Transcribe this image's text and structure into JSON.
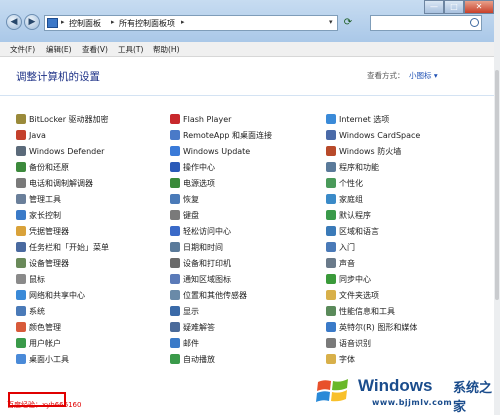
{
  "window": {
    "controls": [
      "—",
      "□",
      "✕"
    ]
  },
  "address": {
    "segments": [
      "控制面板",
      "所有控制面板项"
    ],
    "refresh_icon": "refresh-icon",
    "search_icon": "search-icon"
  },
  "menu": [
    "文件(F)",
    "编辑(E)",
    "查看(V)",
    "工具(T)",
    "帮助(H)"
  ],
  "heading": "调整计算机的设置",
  "view": {
    "label": "查看方式：",
    "value": "小图标 ▾"
  },
  "columns": [
    [
      {
        "label": "BitLocker 驱动器加密",
        "icon": "bitlocker-icon",
        "color": "#9a8a3a"
      },
      {
        "label": "Java",
        "icon": "java-icon",
        "color": "#c4402c"
      },
      {
        "label": "Windows Defender",
        "icon": "defender-icon",
        "color": "#5b6a7a"
      },
      {
        "label": "备份和还原",
        "icon": "backup-icon",
        "color": "#3c8a3c"
      },
      {
        "label": "电话和调制解调器",
        "icon": "phone-icon",
        "color": "#7a7a7a"
      },
      {
        "label": "管理工具",
        "icon": "admin-tools-icon",
        "color": "#6a7f9a"
      },
      {
        "label": "家长控制",
        "icon": "parental-controls-icon",
        "color": "#3a7ac8"
      },
      {
        "label": "凭据管理器",
        "icon": "credential-manager-icon",
        "color": "#d9a23a"
      },
      {
        "label": "任务栏和「开始」菜单",
        "icon": "taskbar-icon",
        "color": "#4a6aa0"
      },
      {
        "label": "设备管理器",
        "icon": "device-manager-icon",
        "color": "#6a8a5a"
      },
      {
        "label": "鼠标",
        "icon": "mouse-icon",
        "color": "#8a8a8a"
      },
      {
        "label": "网络和共享中心",
        "icon": "network-icon",
        "color": "#3a8ad8"
      },
      {
        "label": "系统",
        "icon": "system-icon",
        "color": "#4a7ab8"
      },
      {
        "label": "颜色管理",
        "icon": "color-management-icon",
        "color": "#d85a3a"
      },
      {
        "label": "用户帐户",
        "icon": "user-accounts-icon",
        "color": "#3a9a4a"
      },
      {
        "label": "桌面小工具",
        "icon": "gadgets-icon",
        "color": "#4a8ad8"
      }
    ],
    [
      {
        "label": "Flash Player",
        "icon": "flash-icon",
        "color": "#c8282c"
      },
      {
        "label": "RemoteApp 和桌面连接",
        "icon": "remoteapp-icon",
        "color": "#4a7ac8"
      },
      {
        "label": "Windows Update",
        "icon": "windows-update-icon",
        "color": "#3a7ad8"
      },
      {
        "label": "操作中心",
        "icon": "action-center-icon",
        "color": "#2a5ab8"
      },
      {
        "label": "电源选项",
        "icon": "power-icon",
        "color": "#3a8a3a"
      },
      {
        "label": "恢复",
        "icon": "recovery-icon",
        "color": "#4a7ab8"
      },
      {
        "label": "键盘",
        "icon": "keyboard-icon",
        "color": "#7a7a7a"
      },
      {
        "label": "轻松访问中心",
        "icon": "ease-of-access-icon",
        "color": "#3a6ac8"
      },
      {
        "label": "日期和时间",
        "icon": "date-time-icon",
        "color": "#5a7a9a"
      },
      {
        "label": "设备和打印机",
        "icon": "printer-icon",
        "color": "#6a6a6a"
      },
      {
        "label": "通知区域图标",
        "icon": "notification-icon",
        "color": "#5a7ab8"
      },
      {
        "label": "位置和其他传感器",
        "icon": "sensor-icon",
        "color": "#6a8aa8"
      },
      {
        "label": "显示",
        "icon": "display-icon",
        "color": "#3a6aa8"
      },
      {
        "label": "疑难解答",
        "icon": "troubleshoot-icon",
        "color": "#4a6a9a"
      },
      {
        "label": "邮件",
        "icon": "mail-icon",
        "color": "#3a7ac8"
      },
      {
        "label": "自动播放",
        "icon": "autoplay-icon",
        "color": "#3a9a4a"
      }
    ],
    [
      {
        "label": "Internet 选项",
        "icon": "internet-options-icon",
        "color": "#3a8ad8"
      },
      {
        "label": "Windows CardSpace",
        "icon": "cardspace-icon",
        "color": "#4a6aa8"
      },
      {
        "label": "Windows 防火墙",
        "icon": "firewall-icon",
        "color": "#b84a2a"
      },
      {
        "label": "程序和功能",
        "icon": "programs-icon",
        "color": "#5a7a9a"
      },
      {
        "label": "个性化",
        "icon": "personalization-icon",
        "color": "#4a9a5a"
      },
      {
        "label": "家庭组",
        "icon": "homegroup-icon",
        "color": "#3a8ac8"
      },
      {
        "label": "默认程序",
        "icon": "default-programs-icon",
        "color": "#3a9a4a"
      },
      {
        "label": "区域和语言",
        "icon": "region-icon",
        "color": "#3a7ab8"
      },
      {
        "label": "入门",
        "icon": "getting-started-icon",
        "color": "#4a7ab8"
      },
      {
        "label": "声音",
        "icon": "sound-icon",
        "color": "#6a7a8a"
      },
      {
        "label": "同步中心",
        "icon": "sync-icon",
        "color": "#3a9a3a"
      },
      {
        "label": "文件夹选项",
        "icon": "folder-options-icon",
        "color": "#d8b04a"
      },
      {
        "label": "性能信息和工具",
        "icon": "performance-icon",
        "color": "#5a8a5a"
      },
      {
        "label": "英特尔(R) 图形和媒体",
        "icon": "intel-graphics-icon",
        "color": "#3a7ac8"
      },
      {
        "label": "语音识别",
        "icon": "speech-icon",
        "color": "#7a7a7a"
      },
      {
        "label": "字体",
        "icon": "fonts-icon",
        "color": "#d8b04a"
      }
    ]
  ],
  "watermark": "百度经验：xyb666160",
  "logo": {
    "word": "Windows",
    "zh": "系统之家",
    "url": "www.bjjmlv.com"
  }
}
